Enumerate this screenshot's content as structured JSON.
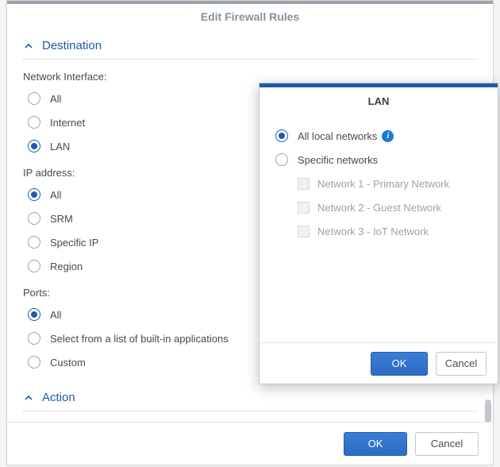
{
  "main": {
    "title": "Edit Firewall Rules",
    "sections": {
      "destination": {
        "label": "Destination",
        "groups": {
          "network_interface": {
            "label": "Network Interface:",
            "options": [
              {
                "label": "All",
                "checked": false
              },
              {
                "label": "Internet",
                "checked": false
              },
              {
                "label": "LAN",
                "checked": true
              }
            ]
          },
          "ip_address": {
            "label": "IP address:",
            "options": [
              {
                "label": "All",
                "checked": true
              },
              {
                "label": "SRM",
                "checked": false
              },
              {
                "label": "Specific IP",
                "checked": false
              },
              {
                "label": "Region",
                "checked": false
              }
            ]
          },
          "ports": {
            "label": "Ports:",
            "options": [
              {
                "label": "All",
                "checked": true
              },
              {
                "label": "Select from a list of built-in applications",
                "checked": false
              },
              {
                "label": "Custom",
                "checked": false
              }
            ]
          }
        }
      },
      "action": {
        "label": "Action"
      }
    },
    "buttons": {
      "ok": "OK",
      "cancel": "Cancel"
    }
  },
  "subdialog": {
    "title": "LAN",
    "options": [
      {
        "label": "All local networks",
        "checked": true,
        "info": true
      },
      {
        "label": "Specific networks",
        "checked": false
      }
    ],
    "networks": [
      {
        "label": "Network 1 - Primary Network",
        "checked": false
      },
      {
        "label": "Network 2 - Guest Network",
        "checked": false
      },
      {
        "label": "Network 3 - IoT Network",
        "checked": false
      }
    ],
    "buttons": {
      "ok": "OK",
      "cancel": "Cancel"
    }
  }
}
